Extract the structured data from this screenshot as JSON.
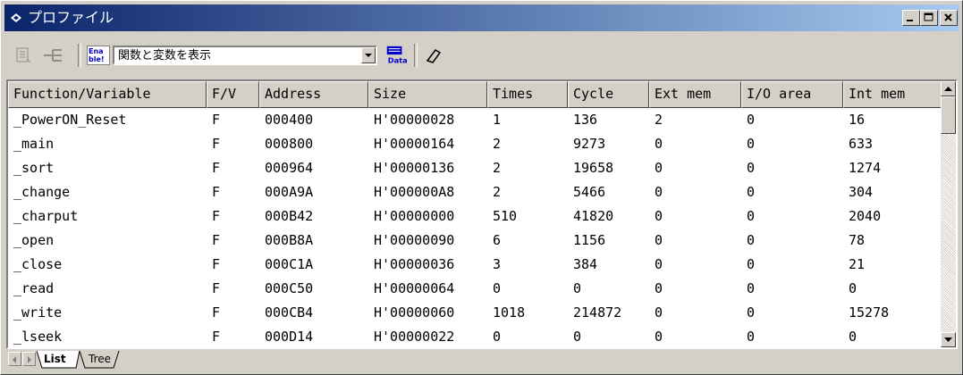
{
  "window": {
    "title": "プロファイル"
  },
  "toolbar": {
    "enable_label": "Ena ble!",
    "display_mode": "関数と変数を表示"
  },
  "table": {
    "columns": [
      "Function/Variable",
      "F/V",
      "Address",
      "Size",
      "Times",
      "Cycle",
      "Ext mem",
      "I/O area",
      "Int mem"
    ],
    "rows": [
      [
        "_PowerON_Reset",
        "F",
        "000400",
        "H'00000028",
        "1",
        "136",
        "2",
        "0",
        "16"
      ],
      [
        "_main",
        "F",
        "000800",
        "H'00000164",
        "2",
        "9273",
        "0",
        "0",
        "633"
      ],
      [
        "_sort",
        "F",
        "000964",
        "H'00000136",
        "2",
        "19658",
        "0",
        "0",
        "1274"
      ],
      [
        "_change",
        "F",
        "000A9A",
        "H'000000A8",
        "2",
        "5466",
        "0",
        "0",
        "304"
      ],
      [
        "_charput",
        "F",
        "000B42",
        "H'00000000",
        "510",
        "41820",
        "0",
        "0",
        "2040"
      ],
      [
        "_open",
        "F",
        "000B8A",
        "H'00000090",
        "6",
        "1156",
        "0",
        "0",
        "78"
      ],
      [
        "_close",
        "F",
        "000C1A",
        "H'00000036",
        "3",
        "384",
        "0",
        "0",
        "21"
      ],
      [
        "_read",
        "F",
        "000C50",
        "H'00000064",
        "0",
        "0",
        "0",
        "0",
        "0"
      ],
      [
        "_write",
        "F",
        "000CB4",
        "H'00000060",
        "1018",
        "214872",
        "0",
        "0",
        "15278"
      ],
      [
        "_lseek",
        "F",
        "000D14",
        "H'00000022",
        "0",
        "0",
        "0",
        "0",
        "0"
      ]
    ]
  },
  "tabs": [
    {
      "label": "List",
      "active": true
    },
    {
      "label": "Tree",
      "active": false
    }
  ],
  "colors": {
    "titlebar_start": "#0a246a",
    "titlebar_end": "#a6caf0",
    "face": "#d4d0c8"
  }
}
